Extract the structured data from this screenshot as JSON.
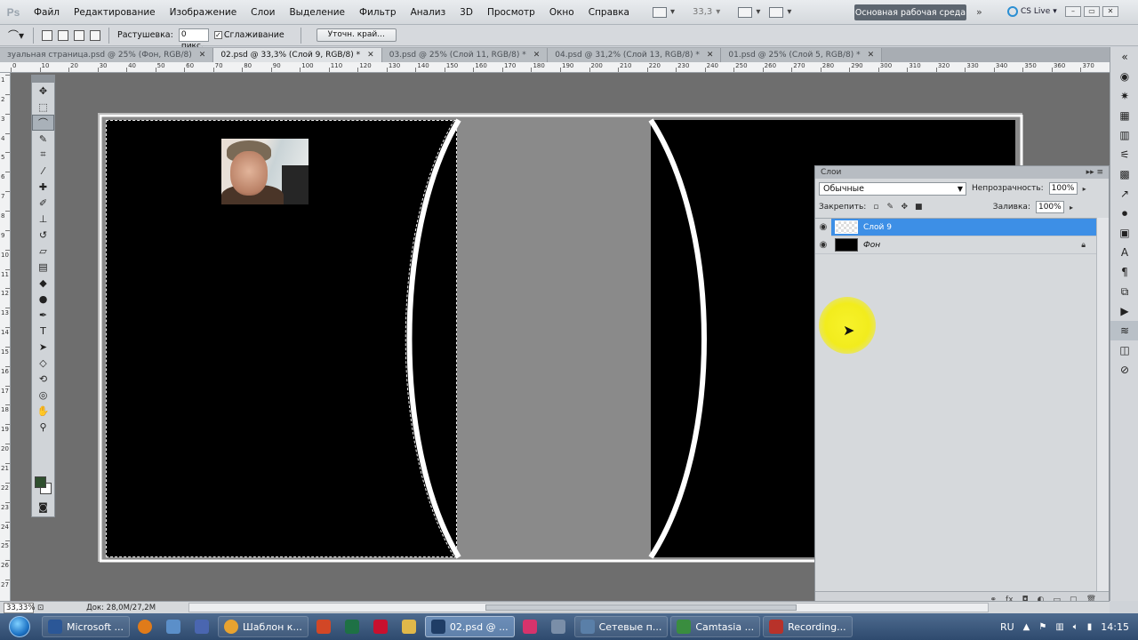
{
  "app": {
    "logo": "Ps"
  },
  "menubar": {
    "items": [
      "Файл",
      "Редактирование",
      "Изображение",
      "Слои",
      "Выделение",
      "Фильтр",
      "Анализ",
      "3D",
      "Просмотр",
      "Окно",
      "Справка"
    ],
    "zoom_value": "33,3",
    "workspace_label": "Основная рабочая среда",
    "cslive_label": "CS Live"
  },
  "optbar": {
    "feather_label": "Растушевка:",
    "feather_value": "0 пикс.",
    "antialias_label": "Сглаживание",
    "antialias_checked": true,
    "refine_edge_label": "Уточн. край..."
  },
  "tabs": [
    {
      "label": "зуальная страница.psd @ 25% (Фон, RGB/8)",
      "active": false
    },
    {
      "label": "02.psd @ 33,3% (Слой 9, RGB/8) *",
      "active": true
    },
    {
      "label": "03.psd @ 25% (Слой 11, RGB/8) *",
      "active": false
    },
    {
      "label": "04.psd @ 31,2% (Слой 13, RGB/8) *",
      "active": false
    },
    {
      "label": "01.psd @ 25% (Слой 5, RGB/8) *",
      "active": false
    }
  ],
  "ruler_top": [
    "0",
    "10",
    "20",
    "30",
    "40",
    "50",
    "60",
    "70",
    "80",
    "90",
    "100",
    "110",
    "120",
    "130",
    "140",
    "150",
    "160",
    "170",
    "180",
    "190",
    "200",
    "210",
    "220",
    "230",
    "240",
    "250",
    "260",
    "270",
    "280",
    "290",
    "300",
    "310",
    "320",
    "330",
    "340",
    "350",
    "360",
    "370"
  ],
  "ruler_left": [
    "1",
    "2",
    "3",
    "4",
    "5",
    "6",
    "7",
    "8",
    "9",
    "10",
    "11",
    "12",
    "13",
    "14",
    "15",
    "16",
    "17",
    "18",
    "19",
    "20",
    "21",
    "22",
    "23",
    "24",
    "25",
    "26",
    "27"
  ],
  "layers_panel": {
    "title": "Слои",
    "blend_mode": "Обычные",
    "opacity_label": "Непрозрачность:",
    "opacity_value": "100%",
    "lock_label": "Закрепить:",
    "fill_label": "Заливка:",
    "fill_value": "100%",
    "layers": [
      {
        "name": "Слой 9",
        "active": true,
        "thumb": "transparent"
      },
      {
        "name": "Фон",
        "active": false,
        "thumb": "black",
        "locked": true
      }
    ]
  },
  "statusbar": {
    "zoom": "33,33%",
    "doc_info": "Док: 28,0M/27,2M"
  },
  "taskbar": {
    "buttons": [
      {
        "label": "Microsoft ...",
        "color": "#2b5797",
        "active": false
      },
      {
        "label": "Шаблон к...",
        "color": "#e8a330",
        "active": false
      },
      {
        "label": "02.psd @ ...",
        "color": "#1f3d66",
        "active": true
      },
      {
        "label": "Сетевые п...",
        "color": "#5a7fa8",
        "active": false
      },
      {
        "label": "Camtasia ...",
        "color": "#3a8d3f",
        "active": false
      },
      {
        "label": "Recording...",
        "color": "#b8322a",
        "active": false
      }
    ],
    "lang": "RU",
    "time": "14:15"
  }
}
